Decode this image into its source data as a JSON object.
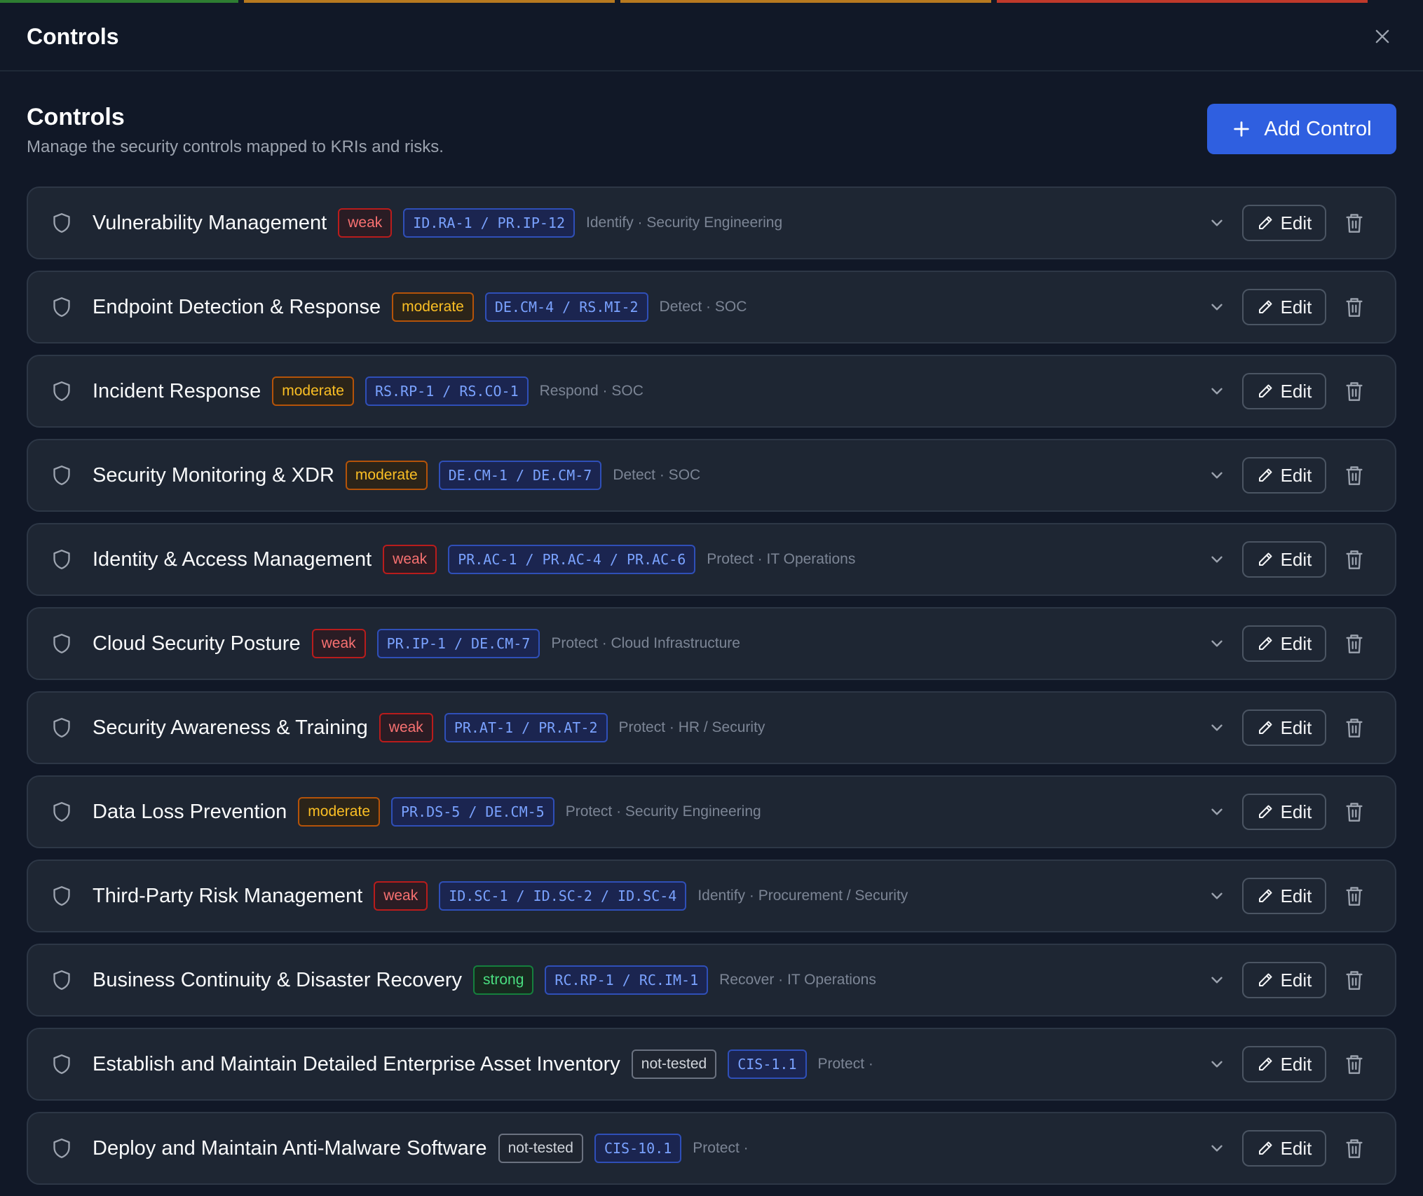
{
  "window": {
    "title": "Controls"
  },
  "topbar_colors": [
    "#2e7d32",
    "#b7791f",
    "#b7791f",
    "#c0392b"
  ],
  "section": {
    "title": "Controls",
    "subtitle": "Manage the security controls mapped to KRIs and risks.",
    "add_label": "Add Control"
  },
  "row_actions": {
    "edit_label": "Edit"
  },
  "controls": [
    {
      "name": "Vulnerability Management",
      "status": "weak",
      "code": "ID.RA-1 / PR.IP-12",
      "meta": "Identify · Security Engineering"
    },
    {
      "name": "Endpoint Detection & Response",
      "status": "moderate",
      "code": "DE.CM-4 / RS.MI-2",
      "meta": "Detect · SOC"
    },
    {
      "name": "Incident Response",
      "status": "moderate",
      "code": "RS.RP-1 / RS.CO-1",
      "meta": "Respond · SOC"
    },
    {
      "name": "Security Monitoring & XDR",
      "status": "moderate",
      "code": "DE.CM-1 / DE.CM-7",
      "meta": "Detect · SOC"
    },
    {
      "name": "Identity & Access Management",
      "status": "weak",
      "code": "PR.AC-1 / PR.AC-4 / PR.AC-6",
      "meta": "Protect · IT Operations"
    },
    {
      "name": "Cloud Security Posture",
      "status": "weak",
      "code": "PR.IP-1 / DE.CM-7",
      "meta": "Protect · Cloud Infrastructure"
    },
    {
      "name": "Security Awareness & Training",
      "status": "weak",
      "code": "PR.AT-1 / PR.AT-2",
      "meta": "Protect · HR / Security"
    },
    {
      "name": "Data Loss Prevention",
      "status": "moderate",
      "code": "PR.DS-5 / DE.CM-5",
      "meta": "Protect · Security Engineering"
    },
    {
      "name": "Third-Party Risk Management",
      "status": "weak",
      "code": "ID.SC-1 / ID.SC-2 / ID.SC-4",
      "meta": "Identify · Procurement / Security"
    },
    {
      "name": "Business Continuity & Disaster Recovery",
      "status": "strong",
      "code": "RC.RP-1 / RC.IM-1",
      "meta": "Recover · IT Operations"
    },
    {
      "name": "Establish and Maintain Detailed Enterprise Asset Inventory",
      "status": "not-tested",
      "code": "CIS-1.1",
      "meta": "Protect ·"
    },
    {
      "name": "Deploy and Maintain Anti-Malware Software",
      "status": "not-tested",
      "code": "CIS-10.1",
      "meta": "Protect ·"
    }
  ]
}
